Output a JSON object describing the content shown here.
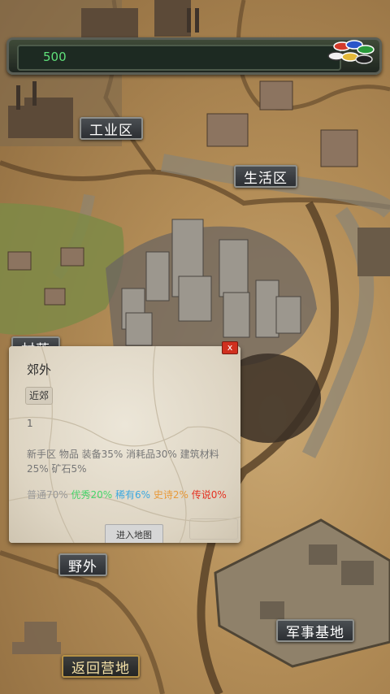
{
  "topbar": {
    "gold": "500"
  },
  "zones": {
    "industrial": "工业区",
    "residential": "生活区",
    "village": "村落",
    "outskirts": "野外",
    "military": "军事基地",
    "return": "返回营地"
  },
  "dialog": {
    "close": "x",
    "title": "郊外",
    "tag": "近郊",
    "level": "1",
    "description": "新手区 物品 装备35%  消耗品30%  建筑材料25% 矿石5%",
    "rarity": {
      "common": "普通70%",
      "fine": "优秀20%",
      "rare": "稀有6%",
      "epic": "史诗2%",
      "legend": "传说0%"
    },
    "enter_button": "进入地图"
  },
  "colors": {
    "gold_text": "#5fe07a",
    "close_button": "#d0301f",
    "rarity_common": "#9a9a9a",
    "rarity_fine": "#46d46a",
    "rarity_rare": "#3ba8e0",
    "rarity_epic": "#e89a3a",
    "rarity_legend": "#e53222"
  }
}
